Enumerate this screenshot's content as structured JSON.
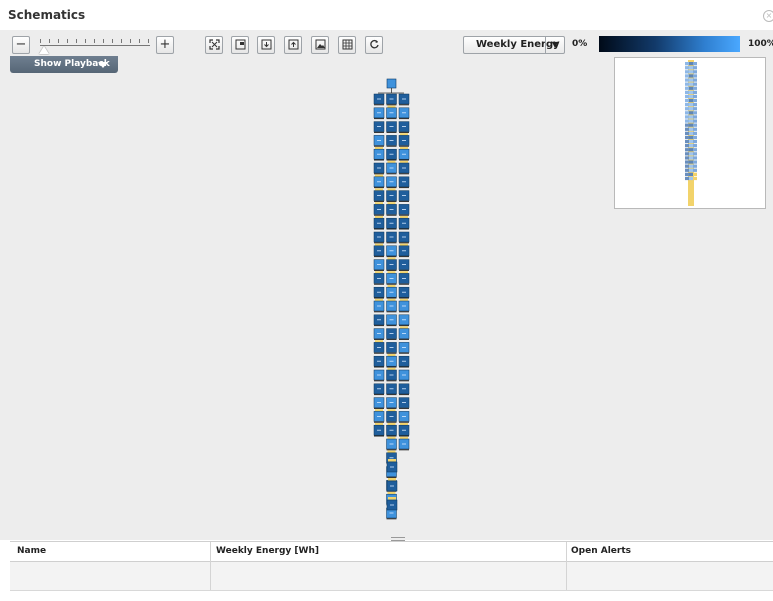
{
  "panel": {
    "title": "Schematics"
  },
  "toolbar": {
    "zoom_out_label": "−",
    "zoom_in_label": "+",
    "tools": [
      "fit-icon",
      "panel-icon",
      "download-icon",
      "upload-icon",
      "image-icon",
      "grid-icon",
      "refresh-icon"
    ],
    "metric": "Weekly Energy",
    "legend_min": "0%",
    "legend_max": "100%"
  },
  "playback": {
    "label": "Show Playback"
  },
  "schematic": {
    "gateway_icon": "gateway-icon",
    "module_icon": "solar-panel-icon",
    "colors": {
      "dark": "#1f5e9c",
      "light": "#3f92dc",
      "string": "#f2d36b"
    },
    "columns": [
      31,
      31,
      26
    ]
  },
  "table": {
    "columns": [
      "Name",
      "Weekly Energy [Wh]",
      "Open Alerts"
    ],
    "rows": []
  }
}
